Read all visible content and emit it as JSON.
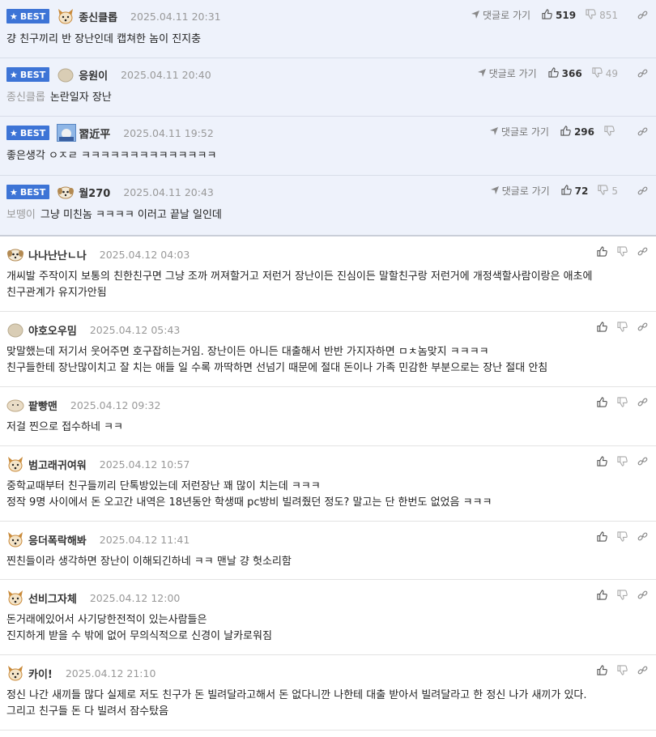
{
  "labels": {
    "best": "BEST",
    "goto": "댓글로 가기"
  },
  "colors": {
    "best_badge": "#3d74d6",
    "best_row_bg": "#eef2fb",
    "date": "#999999"
  },
  "best_comments": [
    {
      "avatar": "dog-face",
      "nick": "종신클롭",
      "date": "2025.04.11 20:31",
      "prefix": "",
      "text": "걍 친구끼리 반 장난인데 캡쳐한 놈이 진지충",
      "up": "519",
      "down": "851"
    },
    {
      "avatar": "round-gray",
      "nick": "응원이",
      "date": "2025.04.11 20:40",
      "prefix": "종신클롭",
      "text": "논란일자 장난",
      "up": "366",
      "down": "49"
    },
    {
      "avatar": "photo",
      "nick": "習近平",
      "date": "2025.04.11 19:52",
      "prefix": "",
      "text": "좋은생각 ㅇㅈㄹ ㅋㅋㅋㅋㅋㅋㅋㅋㅋㅋㅋㅋㅋㅋ",
      "up": "296",
      "down": ""
    },
    {
      "avatar": "puppy",
      "nick": "월270",
      "date": "2025.04.11 20:43",
      "prefix": "보뗑이",
      "text": "그냥 미친놈 ㅋㅋㅋㅋ 이러고 끝날 일인데",
      "up": "72",
      "down": "5"
    }
  ],
  "comments": [
    {
      "avatar": "puppy",
      "nick": "나나난난ㄴ나",
      "date": "2025.04.12 04:03",
      "lines": [
        "개씨발 주작이지 보통의 친한친구면 그냥 조까 꺼져할거고 저런거 장난이든 진심이든 말할친구랑 저런거에 개정색할사람이랑은 애초에",
        "친구관계가 유지가안됨"
      ]
    },
    {
      "avatar": "round-gray",
      "nick": "야호오우밈",
      "date": "2025.04.12 05:43",
      "lines": [
        "맞말했는데 저기서 웃어주면 호구잡히는거임. 장난이든 아니든 대출해서 반반 가지자하면 ㅁㅊ놈맞지 ㅋㅋㅋㅋ",
        "친구들한테 장난많이치고 잘 치는 애들 일 수록 까딱하면 선넘기 때문에 절대 돈이나 가족 민감한 부분으로는 장난 절대 안침"
      ]
    },
    {
      "avatar": "blob",
      "nick": "팥빵맨",
      "date": "2025.04.12 09:32",
      "lines": [
        "저걸 찐으로 접수하네 ㅋㅋ"
      ]
    },
    {
      "avatar": "dog-face",
      "nick": "범고래귀여워",
      "date": "2025.04.12 10:57",
      "lines": [
        "중학교때부터 친구들끼리 단톡방있는데 저런장난 꽤 많이 치는데 ㅋㅋㅋ",
        "정작 9명 사이에서 돈 오고간 내역은 18년동안 학생때 pc방비 빌려줬던 정도? 말고는 단 한번도 없었음 ㅋㅋㅋ"
      ]
    },
    {
      "avatar": "dog-face",
      "nick": "응더폭락해봐",
      "date": "2025.04.12 11:41",
      "lines": [
        "찐친들이라 생각하면 장난이 이해되긴하네 ㅋㅋ 맨날 걍 헛소리함"
      ]
    },
    {
      "avatar": "dog-face",
      "nick": "선비그자체",
      "date": "2025.04.12 12:00",
      "lines": [
        "돈거래에있어서 사기당한전적이 있는사람들은",
        "진지하게 받을 수 밖에 없어 무의식적으로 신경이 날카로워짐"
      ]
    },
    {
      "avatar": "dog-face",
      "nick": "카이!",
      "date": "2025.04.12 21:10",
      "lines": [
        "정신 나간 새끼들 많다 실제로 저도 친구가 돈 빌려달라고해서 돈 없다니깐 나한테 대출 받아서 빌려달라고 한 정신 나가 새끼가 있다.",
        "그리고 친구들 돈 다 빌려서 잠수탔음"
      ]
    }
  ]
}
